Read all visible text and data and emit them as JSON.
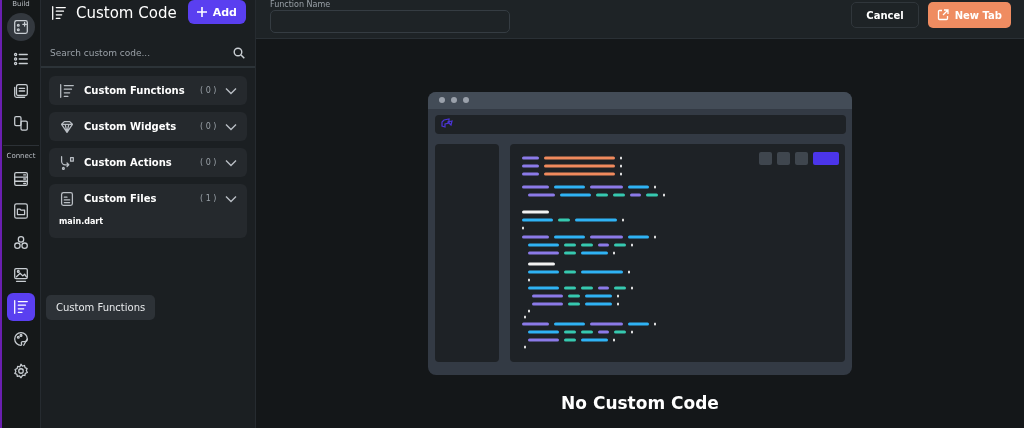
{
  "rail": {
    "sections": [
      {
        "label": "Build",
        "items": [
          {
            "kind": "widget-add",
            "selected": false,
            "hovered": true
          },
          {
            "kind": "list",
            "selected": false,
            "hovered": false
          },
          {
            "kind": "pages",
            "selected": false,
            "hovered": false
          },
          {
            "kind": "devices",
            "selected": false,
            "hovered": false
          }
        ]
      },
      {
        "label": "Connect",
        "items": [
          {
            "kind": "database",
            "selected": false,
            "hovered": false
          },
          {
            "kind": "folder",
            "selected": false,
            "hovered": false
          },
          {
            "kind": "nodes",
            "selected": false,
            "hovered": false
          },
          {
            "kind": "image",
            "selected": false,
            "hovered": false
          },
          {
            "kind": "code",
            "selected": true,
            "hovered": false
          },
          {
            "kind": "palette",
            "selected": false,
            "hovered": false
          },
          {
            "kind": "gear",
            "selected": false,
            "hovered": false
          }
        ]
      }
    ],
    "tooltip": "Custom Functions"
  },
  "panel": {
    "title": "Custom Code",
    "add_button": "Add",
    "search": {
      "placeholder": "Search custom code..."
    },
    "sections": [
      {
        "kind": "function",
        "title": "Custom Functions",
        "count": "( 0 )"
      },
      {
        "kind": "diamond",
        "title": "Custom Widgets",
        "count": "( 0 )"
      },
      {
        "kind": "action",
        "title": "Custom Actions",
        "count": "( 0 )"
      },
      {
        "kind": "file",
        "title": "Custom Files",
        "count": "( 1 )",
        "children": [
          "main.dart"
        ]
      }
    ]
  },
  "toolbar": {
    "field_label": "Function Name",
    "cancel_button": "Cancel",
    "new_tab_button": "New Tab"
  },
  "empty_state": {
    "title": "No Custom Code"
  }
}
